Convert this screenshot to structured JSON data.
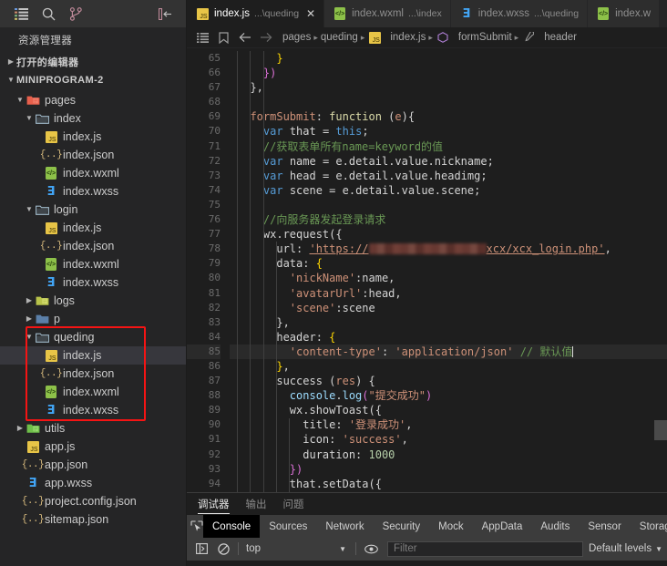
{
  "activity_bar": {
    "icons": [
      {
        "name": "explorer-icon",
        "glyph": "list"
      },
      {
        "name": "search-icon",
        "glyph": "magnifier"
      },
      {
        "name": "source-control-icon",
        "glyph": "branch"
      }
    ],
    "collapse_label": "collapse-sidebar-icon"
  },
  "sidebar": {
    "title": "资源管理器",
    "open_editors_label": "打开的编辑器",
    "project_label": "MINIPROGRAM-2",
    "tree": [
      {
        "label": "pages",
        "depth": 1,
        "type": "folder-pages",
        "twisty": "open",
        "selected": false
      },
      {
        "label": "index",
        "depth": 2,
        "type": "folder",
        "twisty": "open",
        "selected": false
      },
      {
        "label": "index.js",
        "depth": 3,
        "type": "js",
        "twisty": "none",
        "selected": false
      },
      {
        "label": "index.json",
        "depth": 3,
        "type": "json",
        "twisty": "none",
        "selected": false
      },
      {
        "label": "index.wxml",
        "depth": 3,
        "type": "wxml",
        "twisty": "none",
        "selected": false
      },
      {
        "label": "index.wxss",
        "depth": 3,
        "type": "wxss",
        "twisty": "none",
        "selected": false
      },
      {
        "label": "login",
        "depth": 2,
        "type": "folder",
        "twisty": "open",
        "selected": false
      },
      {
        "label": "index.js",
        "depth": 3,
        "type": "js",
        "twisty": "none",
        "selected": false
      },
      {
        "label": "index.json",
        "depth": 3,
        "type": "json",
        "twisty": "none",
        "selected": false
      },
      {
        "label": "index.wxml",
        "depth": 3,
        "type": "wxml",
        "twisty": "none",
        "selected": false
      },
      {
        "label": "index.wxss",
        "depth": 3,
        "type": "wxss",
        "twisty": "none",
        "selected": false
      },
      {
        "label": "logs",
        "depth": 2,
        "type": "folder-logs",
        "twisty": "closed",
        "selected": false
      },
      {
        "label": "p",
        "depth": 2,
        "type": "folder-p",
        "twisty": "closed",
        "selected": false
      },
      {
        "label": "queding",
        "depth": 2,
        "type": "folder",
        "twisty": "open",
        "selected": false
      },
      {
        "label": "index.js",
        "depth": 3,
        "type": "js",
        "twisty": "none",
        "selected": true
      },
      {
        "label": "index.json",
        "depth": 3,
        "type": "json",
        "twisty": "none",
        "selected": false
      },
      {
        "label": "index.wxml",
        "depth": 3,
        "type": "wxml",
        "twisty": "none",
        "selected": false
      },
      {
        "label": "index.wxss",
        "depth": 3,
        "type": "wxss",
        "twisty": "none",
        "selected": false
      },
      {
        "label": "utils",
        "depth": 1,
        "type": "folder-utils",
        "twisty": "closed",
        "selected": false
      },
      {
        "label": "app.js",
        "depth": 1,
        "type": "js",
        "twisty": "none",
        "selected": false
      },
      {
        "label": "app.json",
        "depth": 1,
        "type": "json",
        "twisty": "none",
        "selected": false
      },
      {
        "label": "app.wxss",
        "depth": 1,
        "type": "wxss",
        "twisty": "none",
        "selected": false
      },
      {
        "label": "project.config.json",
        "depth": 1,
        "type": "json",
        "twisty": "none",
        "selected": false
      },
      {
        "label": "sitemap.json",
        "depth": 1,
        "type": "json",
        "twisty": "none",
        "selected": false
      }
    ],
    "annotation_color": "#f51414"
  },
  "tabs": [
    {
      "name": "index.js",
      "dim": "...\\queding",
      "icon": "js",
      "active": true,
      "close": "✕"
    },
    {
      "name": "index.wxml",
      "dim": "...\\index",
      "icon": "wxml",
      "active": false,
      "close": ""
    },
    {
      "name": "index.wxss",
      "dim": "...\\queding",
      "icon": "wxss",
      "active": false,
      "close": ""
    },
    {
      "name": "index.w",
      "dim": "",
      "icon": "wxml",
      "active": false,
      "close": ""
    }
  ],
  "breadcrumb": {
    "items": [
      {
        "label": "pages",
        "icon": ""
      },
      {
        "label": "queding",
        "icon": ""
      },
      {
        "label": "index.js",
        "icon": "js"
      },
      {
        "label": "formSubmit",
        "icon": "symbol-method"
      },
      {
        "label": "header",
        "icon": "symbol-property"
      }
    ],
    "separator": "›"
  },
  "editor": {
    "first_line": 65,
    "highlighted_line": 85,
    "lines": [
      {
        "n": 65,
        "indent": 3,
        "tokens": [
          {
            "t": "      ",
            "c": "plain"
          },
          {
            "t": "}",
            "c": "br1"
          }
        ]
      },
      {
        "n": 66,
        "indent": 2,
        "tokens": [
          {
            "t": "    ",
            "c": "plain"
          },
          {
            "t": "})",
            "c": "br2"
          }
        ]
      },
      {
        "n": 67,
        "indent": 1,
        "tokens": [
          {
            "t": "  ",
            "c": "plain"
          },
          {
            "t": "},",
            "c": "plain"
          }
        ]
      },
      {
        "n": 68,
        "indent": 1,
        "tokens": []
      },
      {
        "n": 69,
        "indent": 1,
        "tokens": [
          {
            "t": "  ",
            "c": "plain"
          },
          {
            "t": "formSubmit",
            "c": "ora"
          },
          {
            "t": ": ",
            "c": "plain"
          },
          {
            "t": "function",
            "c": "fn"
          },
          {
            "t": " (",
            "c": "plain"
          },
          {
            "t": "e",
            "c": "ora"
          },
          {
            "t": "){",
            "c": "plain"
          }
        ]
      },
      {
        "n": 70,
        "indent": 2,
        "tokens": [
          {
            "t": "    ",
            "c": "plain"
          },
          {
            "t": "var",
            "c": "key"
          },
          {
            "t": " that ",
            "c": "plain"
          },
          {
            "t": "=",
            "c": "plain"
          },
          {
            "t": " ",
            "c": "plain"
          },
          {
            "t": "this",
            "c": "key"
          },
          {
            "t": ";",
            "c": "plain"
          }
        ]
      },
      {
        "n": 71,
        "indent": 2,
        "tokens": [
          {
            "t": "    ",
            "c": "plain"
          },
          {
            "t": "//获取表单所有name=keyword的值",
            "c": "com"
          }
        ]
      },
      {
        "n": 72,
        "indent": 2,
        "tokens": [
          {
            "t": "    ",
            "c": "plain"
          },
          {
            "t": "var",
            "c": "key"
          },
          {
            "t": " name ",
            "c": "plain"
          },
          {
            "t": "=",
            "c": "plain"
          },
          {
            "t": " e.detail.value.nickname;",
            "c": "plain"
          }
        ]
      },
      {
        "n": 73,
        "indent": 2,
        "tokens": [
          {
            "t": "    ",
            "c": "plain"
          },
          {
            "t": "var",
            "c": "key"
          },
          {
            "t": " head ",
            "c": "plain"
          },
          {
            "t": "=",
            "c": "plain"
          },
          {
            "t": " e.detail.value.headimg;",
            "c": "plain"
          }
        ]
      },
      {
        "n": 74,
        "indent": 2,
        "tokens": [
          {
            "t": "    ",
            "c": "plain"
          },
          {
            "t": "var",
            "c": "key"
          },
          {
            "t": " scene ",
            "c": "plain"
          },
          {
            "t": "=",
            "c": "plain"
          },
          {
            "t": " e.detail.value.scene;",
            "c": "plain"
          }
        ]
      },
      {
        "n": 75,
        "indent": 2,
        "tokens": []
      },
      {
        "n": 76,
        "indent": 2,
        "tokens": [
          {
            "t": "    ",
            "c": "plain"
          },
          {
            "t": "//向服务器发起登录请求",
            "c": "com"
          }
        ]
      },
      {
        "n": 77,
        "indent": 2,
        "tokens": [
          {
            "t": "    ",
            "c": "plain"
          },
          {
            "t": "wx.request({",
            "c": "plain"
          }
        ]
      },
      {
        "n": 78,
        "indent": 3,
        "tokens": [
          {
            "t": "      ",
            "c": "plain"
          },
          {
            "t": "url",
            "c": "plain"
          },
          {
            "t": ": ",
            "c": "plain"
          },
          {
            "t": "'https://",
            "c": "url"
          },
          {
            "t": "REDACT",
            "c": "redact"
          },
          {
            "t": "xcx/xcx_login.php'",
            "c": "url"
          },
          {
            "t": ",",
            "c": "plain"
          }
        ]
      },
      {
        "n": 79,
        "indent": 3,
        "tokens": [
          {
            "t": "      ",
            "c": "plain"
          },
          {
            "t": "data",
            "c": "plain"
          },
          {
            "t": ": ",
            "c": "plain"
          },
          {
            "t": "{",
            "c": "br1"
          }
        ]
      },
      {
        "n": 80,
        "indent": 4,
        "tokens": [
          {
            "t": "        ",
            "c": "plain"
          },
          {
            "t": "'nickName'",
            "c": "str"
          },
          {
            "t": ":name,",
            "c": "plain"
          }
        ]
      },
      {
        "n": 81,
        "indent": 4,
        "tokens": [
          {
            "t": "        ",
            "c": "plain"
          },
          {
            "t": "'avatarUrl'",
            "c": "str"
          },
          {
            "t": ":head,",
            "c": "plain"
          }
        ]
      },
      {
        "n": 82,
        "indent": 4,
        "tokens": [
          {
            "t": "        ",
            "c": "plain"
          },
          {
            "t": "'scene'",
            "c": "str"
          },
          {
            "t": ":scene",
            "c": "plain"
          }
        ]
      },
      {
        "n": 83,
        "indent": 3,
        "tokens": [
          {
            "t": "      ",
            "c": "plain"
          },
          {
            "t": "},",
            "c": "plain"
          }
        ]
      },
      {
        "n": 84,
        "indent": 3,
        "tokens": [
          {
            "t": "      ",
            "c": "plain"
          },
          {
            "t": "header",
            "c": "plain"
          },
          {
            "t": ": ",
            "c": "plain"
          },
          {
            "t": "{",
            "c": "brmatch"
          }
        ]
      },
      {
        "n": 85,
        "indent": 4,
        "tokens": [
          {
            "t": "        ",
            "c": "plain"
          },
          {
            "t": "'content-type'",
            "c": "str"
          },
          {
            "t": ": ",
            "c": "plain"
          },
          {
            "t": "'application/json'",
            "c": "str"
          },
          {
            "t": " ",
            "c": "plain"
          },
          {
            "t": "// 默认值",
            "c": "com"
          },
          {
            "t": "CURSOR",
            "c": "cursor"
          }
        ]
      },
      {
        "n": 86,
        "indent": 3,
        "tokens": [
          {
            "t": "      ",
            "c": "plain"
          },
          {
            "t": "}",
            "c": "brmatch"
          },
          {
            "t": ",",
            "c": "plain"
          }
        ]
      },
      {
        "n": 87,
        "indent": 3,
        "tokens": [
          {
            "t": "      ",
            "c": "plain"
          },
          {
            "t": "success",
            "c": "plain"
          },
          {
            "t": " (",
            "c": "plain"
          },
          {
            "t": "res",
            "c": "param"
          },
          {
            "t": ") {",
            "c": "plain"
          }
        ]
      },
      {
        "n": 88,
        "indent": 4,
        "tokens": [
          {
            "t": "        ",
            "c": "plain"
          },
          {
            "t": "console",
            "c": "var"
          },
          {
            "t": ".",
            "c": "plain"
          },
          {
            "t": "log",
            "c": "var"
          },
          {
            "t": "(",
            "c": "br2"
          },
          {
            "t": "\"提交成功\"",
            "c": "str"
          },
          {
            "t": ")",
            "c": "br2"
          }
        ]
      },
      {
        "n": 89,
        "indent": 4,
        "tokens": [
          {
            "t": "        ",
            "c": "plain"
          },
          {
            "t": "wx.showToast({",
            "c": "plain"
          }
        ]
      },
      {
        "n": 90,
        "indent": 5,
        "tokens": [
          {
            "t": "          ",
            "c": "plain"
          },
          {
            "t": "title",
            "c": "plain"
          },
          {
            "t": ": ",
            "c": "plain"
          },
          {
            "t": "'登录成功'",
            "c": "str"
          },
          {
            "t": ",",
            "c": "plain"
          }
        ]
      },
      {
        "n": 91,
        "indent": 5,
        "tokens": [
          {
            "t": "          ",
            "c": "plain"
          },
          {
            "t": "icon",
            "c": "plain"
          },
          {
            "t": ": ",
            "c": "plain"
          },
          {
            "t": "'success'",
            "c": "str"
          },
          {
            "t": ",",
            "c": "plain"
          }
        ]
      },
      {
        "n": 92,
        "indent": 5,
        "tokens": [
          {
            "t": "          ",
            "c": "plain"
          },
          {
            "t": "duration",
            "c": "plain"
          },
          {
            "t": ": ",
            "c": "plain"
          },
          {
            "t": "1000",
            "c": "num"
          }
        ]
      },
      {
        "n": 93,
        "indent": 4,
        "tokens": [
          {
            "t": "        ",
            "c": "plain"
          },
          {
            "t": "})",
            "c": "br2"
          }
        ]
      },
      {
        "n": 94,
        "indent": 4,
        "tokens": [
          {
            "t": "        ",
            "c": "plain"
          },
          {
            "t": "that.setData({",
            "c": "plain"
          }
        ]
      }
    ]
  },
  "panel": {
    "tabs": [
      {
        "label": "调试器",
        "active": true
      },
      {
        "label": "输出",
        "active": false
      },
      {
        "label": "问题",
        "active": false
      }
    ],
    "devtools_tabs": [
      {
        "label": "Console",
        "active": true
      },
      {
        "label": "Sources",
        "active": false
      },
      {
        "label": "Network",
        "active": false
      },
      {
        "label": "Security",
        "active": false
      },
      {
        "label": "Mock",
        "active": false
      },
      {
        "label": "AppData",
        "active": false
      },
      {
        "label": "Audits",
        "active": false
      },
      {
        "label": "Sensor",
        "active": false
      },
      {
        "label": "Storage",
        "active": false
      }
    ],
    "inspect_icon": "inspect-element-icon",
    "clear_icon": "clear-console-icon",
    "context_value": "top",
    "eye_icon": "live-expression-icon",
    "filter_placeholder": "Filter",
    "levels_label": "Default levels"
  },
  "colors": {
    "accent_red": "#f51414",
    "editor_bg": "#1e1e1e",
    "sidebar_bg": "#252526",
    "activity_bg": "#333333",
    "selection": "#37373d"
  }
}
